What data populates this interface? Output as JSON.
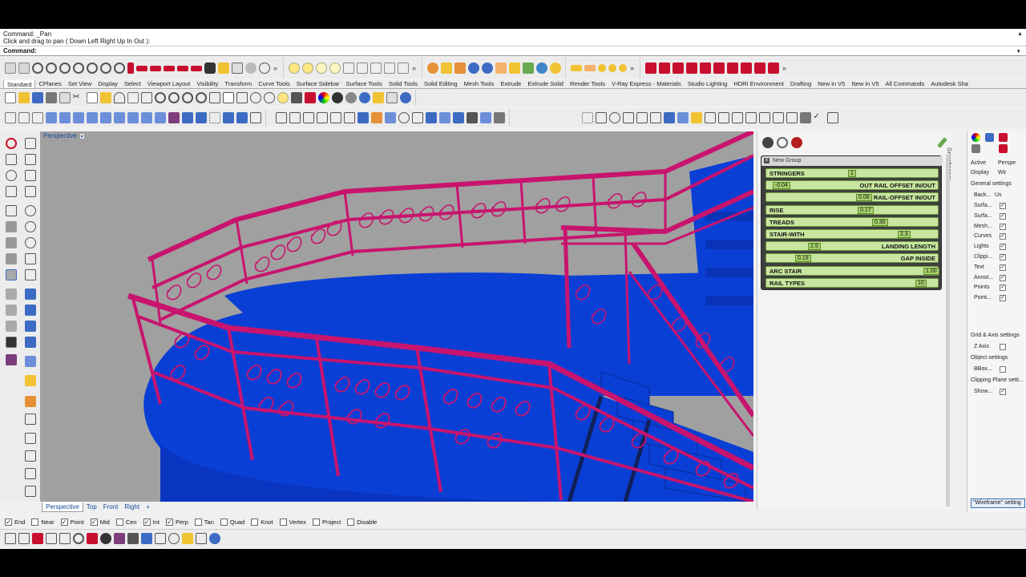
{
  "command": {
    "history_line1": "Command: _Pan",
    "history_line2": "Click and drag to pan ( Down  Left  Right  Up  In  Out ):",
    "prompt": "Command:"
  },
  "toolbar_tabs": [
    "Standard",
    "CPlanes",
    "Set View",
    "Display",
    "Select",
    "Viewport Layout",
    "Visibility",
    "Transform",
    "Curve Tools",
    "Surface Sidebar",
    "Surface Tools",
    "Solid Tools",
    "Solid Editing",
    "Mesh Tools",
    "Extrude",
    "Extrude Solid",
    "Render Tools",
    "V-Ray Express - Materials",
    "Studio Lighting",
    "HDRI Environment",
    "Drafting",
    "New in V5",
    "New in V5",
    "All Commands",
    "Autodesk Sha"
  ],
  "viewport": {
    "label": "Perspective",
    "tabs": [
      "Perspective",
      "Top",
      "Front",
      "Right"
    ],
    "add_tab": "+"
  },
  "grasshopper": {
    "side_label": "Grasshopper",
    "group_name": "New Group",
    "close_glyph": "x",
    "sliders": [
      {
        "name": "STRINGERS",
        "value": "1",
        "align": "left"
      },
      {
        "name": "OUT RAIL OFFSET IN/OUT",
        "value": "-0.04",
        "align": "right"
      },
      {
        "name": "RAIL-OFFSET IN/OUT",
        "value": "0.08",
        "align": "right"
      },
      {
        "name": "RISE",
        "value": "0.17",
        "align": "left"
      },
      {
        "name": "TREADS",
        "value": "0.30",
        "align": "left"
      },
      {
        "name": "STAIR-WITH",
        "value": "2.3",
        "align": "left"
      },
      {
        "name": "LANDING LENGTH",
        "value": "2.5",
        "align": "right"
      },
      {
        "name": "GAP INSIDE",
        "value": "0.19",
        "align": "right"
      },
      {
        "name": "ARC STAIR",
        "value": "1.00",
        "align": "left"
      },
      {
        "name": "RAIL TYPES",
        "value": "10",
        "align": "left"
      }
    ]
  },
  "properties": {
    "active_label": "Active",
    "active_value": "Perspe",
    "display_label": "Display",
    "display_value": "Wir",
    "general_header": "General settings",
    "back_label": "Back...",
    "back_value": "Us",
    "items": [
      {
        "label": "Surfa...",
        "checked": true
      },
      {
        "label": "Surfa...",
        "checked": true
      },
      {
        "label": "Mesh...",
        "checked": true
      },
      {
        "label": "Curves",
        "checked": true
      },
      {
        "label": "Lights",
        "checked": true
      },
      {
        "label": "Clippi...",
        "checked": true
      },
      {
        "label": "Text",
        "checked": true
      },
      {
        "label": "Annot...",
        "checked": true
      },
      {
        "label": "Points",
        "checked": true
      },
      {
        "label": "Point...",
        "checked": true
      }
    ],
    "grid_header": "Grid & Axis settings",
    "zaxis_label": "Z Axis",
    "object_header": "Object settings",
    "bbox_label": "BBox...",
    "clipping_header": "Clipping Plane setti...",
    "show_label": "Show...",
    "footer": "\"Wireframe\" setting"
  },
  "osnaps": [
    {
      "label": "End",
      "checked": true
    },
    {
      "label": "Near",
      "checked": false
    },
    {
      "label": "Point",
      "checked": true
    },
    {
      "label": "Mid",
      "checked": true
    },
    {
      "label": "Cen",
      "checked": false
    },
    {
      "label": "Int",
      "checked": true
    },
    {
      "label": "Perp",
      "checked": true
    },
    {
      "label": "Tan",
      "checked": false
    },
    {
      "label": "Quad",
      "checked": false
    },
    {
      "label": "Knot",
      "checked": false
    },
    {
      "label": "Vertex",
      "checked": false
    },
    {
      "label": "Project",
      "checked": false
    },
    {
      "label": "Disable",
      "checked": false
    }
  ],
  "colors": {
    "railing": "#c8146e",
    "stair": "#0a3fd6",
    "slider_bg": "#c8e6a0",
    "viewport_bg": "#a0a0a0"
  },
  "icons": {
    "checkmark": "✓",
    "more": "»",
    "dropdown": "▾"
  }
}
